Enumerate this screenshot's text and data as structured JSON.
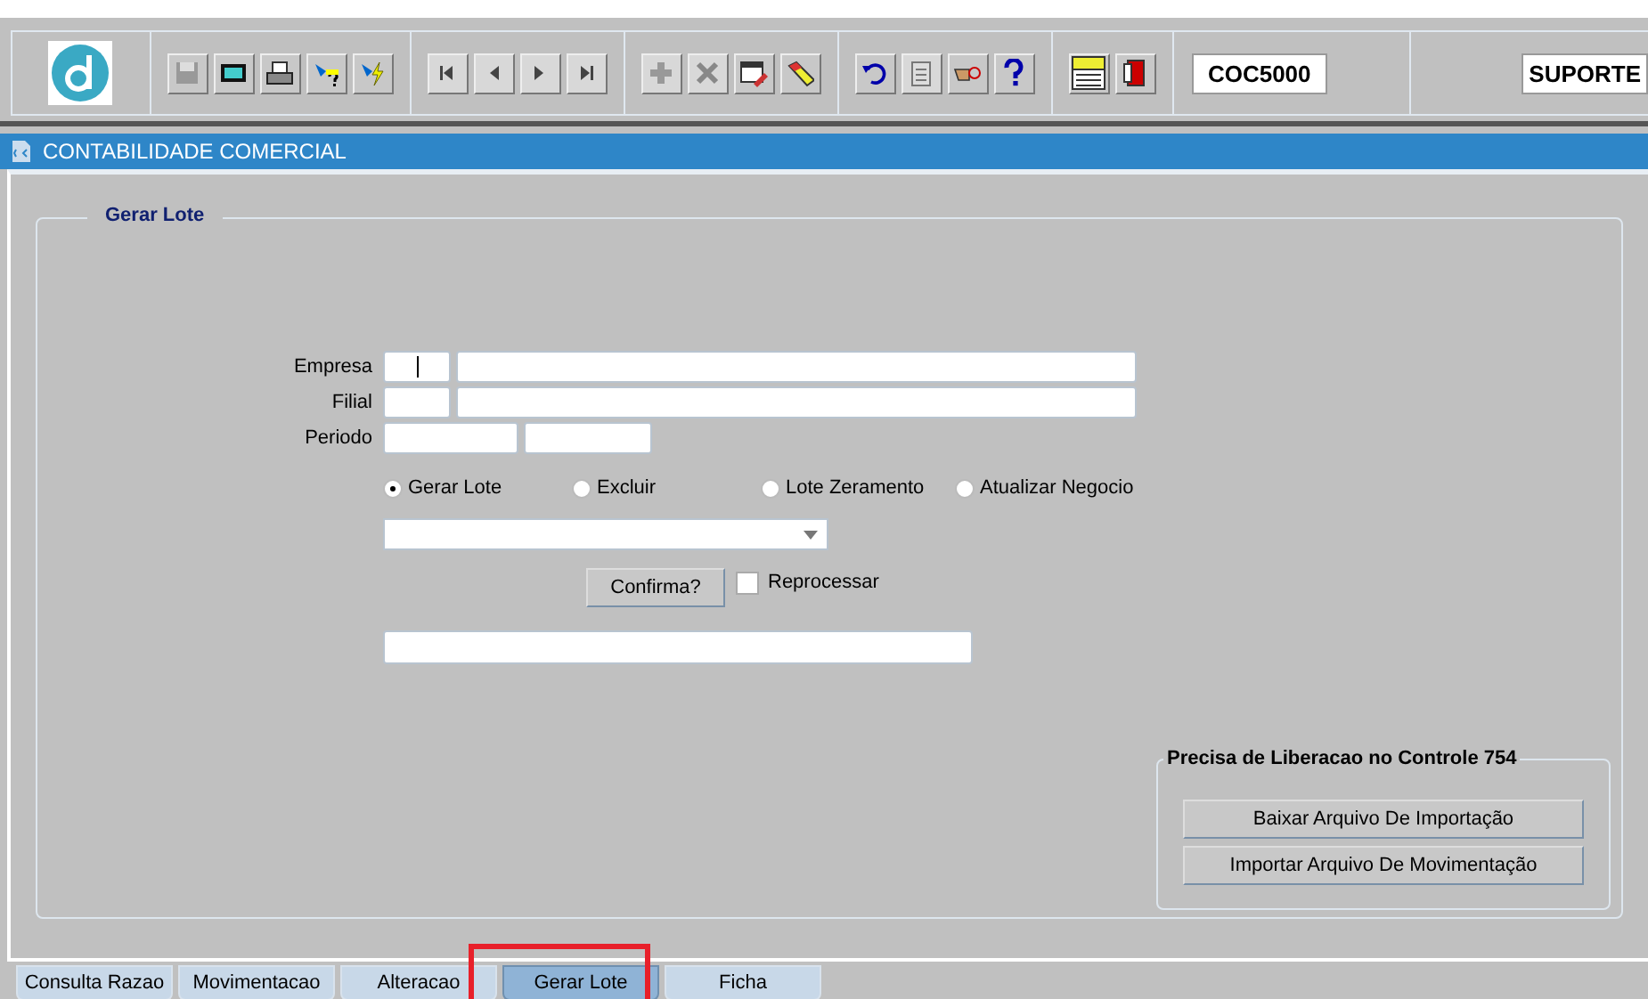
{
  "toolbar": {
    "form_code": "COC5000",
    "user": "SUPORTE"
  },
  "app_title": "CONTABILIDADE COMERCIAL",
  "section": {
    "title": "Gerar Lote"
  },
  "fields": [
    {
      "label": "Empresa",
      "kind": "code-name"
    },
    {
      "label": "Filial",
      "kind": "code-name"
    },
    {
      "label": "Periodo",
      "kind": "range"
    }
  ],
  "options": [
    {
      "label": "Gerar Lote",
      "selected": true
    },
    {
      "label": "Excluir",
      "selected": false
    },
    {
      "label": "Lote Zeramento",
      "selected": false
    },
    {
      "label": "Atualizar Negocio",
      "selected": false
    }
  ],
  "confirm_button": "Confirma?",
  "reprocess": {
    "label": "Reprocessar",
    "checked": false
  },
  "release_panel": {
    "title": "Precisa de Liberacao no Controle 754",
    "buttons": [
      "Baixar Arquivo De Importação",
      "Importar Arquivo De Movimentação"
    ]
  },
  "tabs": [
    {
      "label": "Consulta Razao",
      "selected": false
    },
    {
      "label": "Movimentacao",
      "selected": false
    },
    {
      "label": "Alteracao",
      "selected": false
    },
    {
      "label": "Gerar Lote",
      "selected": true
    },
    {
      "label": "Ficha",
      "selected": false
    }
  ]
}
